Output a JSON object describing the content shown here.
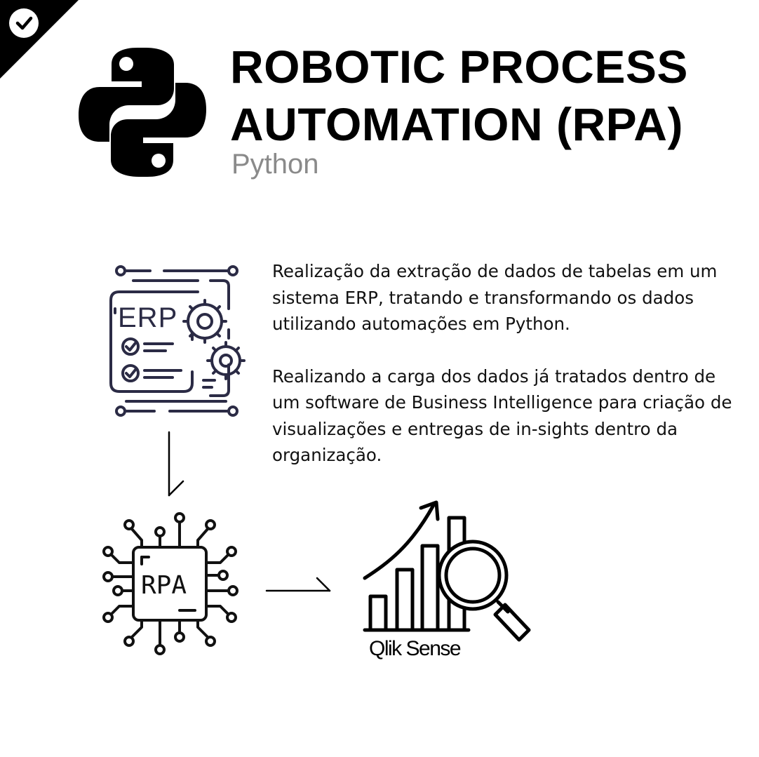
{
  "header": {
    "title_lines": [
      "ROBOTIC PROCESS",
      "AUTOMATION (RPA)"
    ],
    "subtitle": "Python"
  },
  "description": {
    "paragraph_1": "Realização da extração de dados de tabelas em um sistema ERP, tratando e transformando os dados utilizando automações em Python.",
    "paragraph_2": "Realizando a carga dos dados já tratados dentro de um software de Business Intelligence para criação de visualizações e entregas de in-sights dentro da organização."
  },
  "diagram": {
    "erp_label": "ERP",
    "rpa_label": "RPA",
    "bi_label": "Qlik Sense"
  },
  "icons": [
    "check-icon",
    "python-logo-icon",
    "erp-icon",
    "arrow-down-icon",
    "rpa-chip-icon",
    "arrow-right-icon",
    "bar-chart-magnifier-icon"
  ],
  "colors": {
    "primary": "#000000",
    "subtitle": "#8a8a8a",
    "icon_stroke": "#2b2b45"
  }
}
